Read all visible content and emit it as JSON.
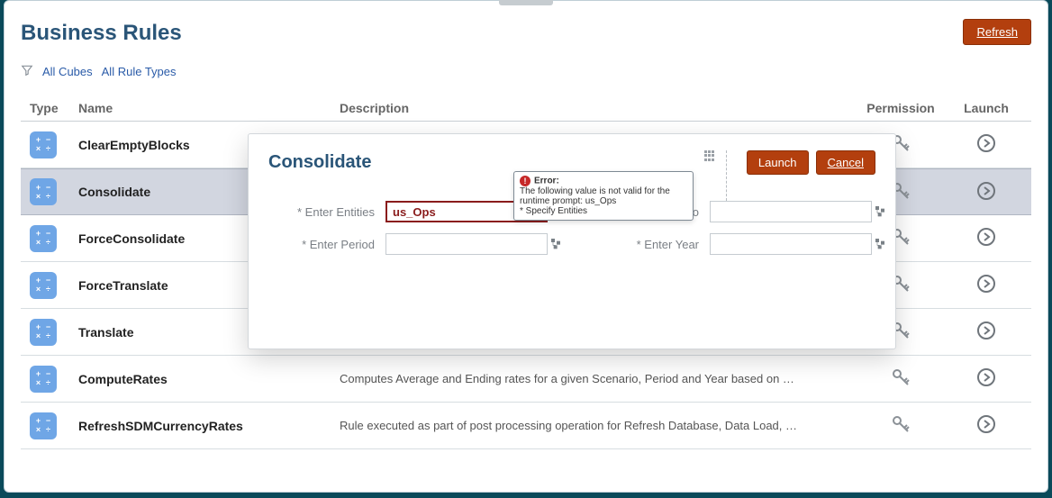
{
  "header": {
    "title": "Business Rules",
    "refresh_label": "Refresh"
  },
  "filters": {
    "cubes": "All Cubes",
    "types": "All Rule Types"
  },
  "columns": {
    "type": "Type",
    "name": "Name",
    "desc": "Description",
    "perm": "Permission",
    "launch": "Launch"
  },
  "rows": [
    {
      "name": "ClearEmptyBlocks",
      "desc": "",
      "selected": false
    },
    {
      "name": "Consolidate",
      "desc": "",
      "selected": true
    },
    {
      "name": "ForceConsolidate",
      "desc": "",
      "selected": false
    },
    {
      "name": "ForceTranslate",
      "desc": "",
      "selected": false
    },
    {
      "name": "Translate",
      "desc": "",
      "selected": false
    },
    {
      "name": "ComputeRates",
      "desc": "Computes Average and Ending rates for a given Scenario, Period and Year based on …",
      "selected": false
    },
    {
      "name": "RefreshSDMCurrencyRates",
      "desc": "Rule executed as part of post processing operation for Refresh Database, Data Load, …",
      "selected": false
    }
  ],
  "dialog": {
    "title": "Consolidate",
    "launch": "Launch",
    "cancel": "Cancel",
    "fields": {
      "entities": {
        "label": "Enter Entities",
        "value": "us_Ops"
      },
      "scenario": {
        "label": "Enter Scenario",
        "value": ""
      },
      "period": {
        "label": "Enter Period",
        "value": ""
      },
      "year": {
        "label": "Enter Year",
        "value": ""
      }
    },
    "error": {
      "title": "Error:",
      "msg": "The following value is not valid for the runtime prompt: us_Ops",
      "hint": "* Specify Entities"
    }
  }
}
